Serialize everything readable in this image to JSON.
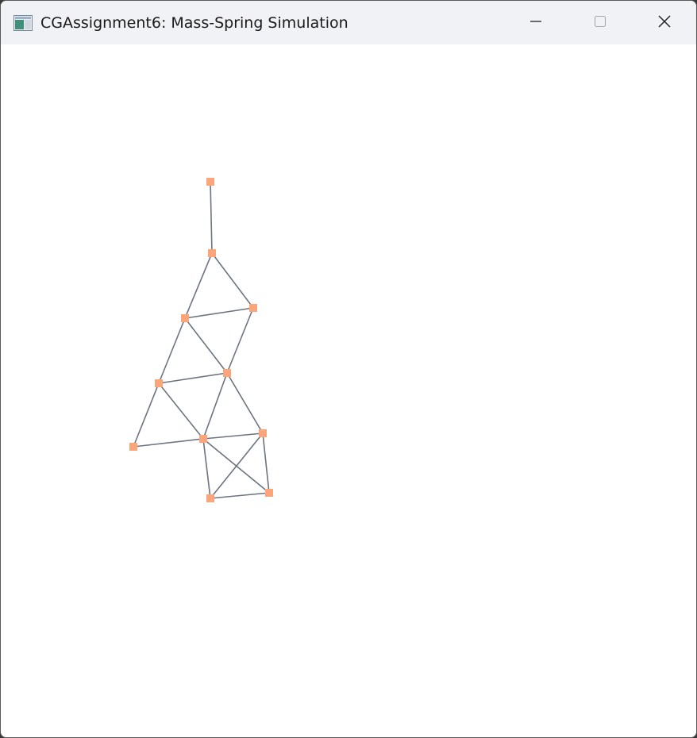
{
  "window": {
    "title": "CGAssignment6: Mass-Spring Simulation",
    "icons": {
      "app": "app-window-icon",
      "minimize": "minimize-icon",
      "maximize": "maximize-icon",
      "close": "close-icon"
    }
  },
  "colors": {
    "titlebar_bg": "#f1f2f6",
    "canvas_bg": "#ffffff",
    "spring": "#6b7480",
    "mass": "#fda57a"
  }
}
